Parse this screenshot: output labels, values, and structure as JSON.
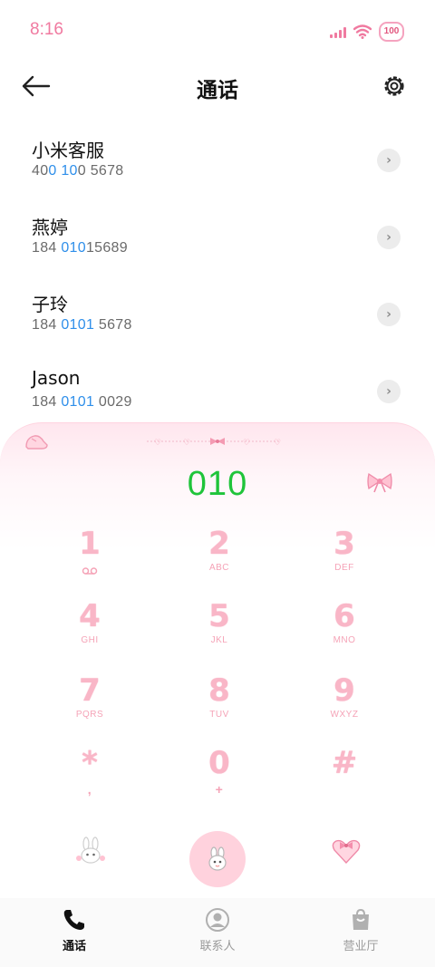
{
  "status_bar": {
    "time": "8:16",
    "battery": "100"
  },
  "header": {
    "title": "通话"
  },
  "contacts": [
    {
      "name": "小米客服",
      "number_parts": [
        "40",
        "0 10",
        "0 5678"
      ]
    },
    {
      "name": "燕婷",
      "number_parts": [
        "184 ",
        "010",
        "15689"
      ]
    },
    {
      "name": "子玲",
      "number_parts": [
        "184 ",
        "0101",
        " 5678"
      ]
    },
    {
      "name": "Jason",
      "number_parts": [
        "184 ",
        "0101",
        " 0029"
      ]
    }
  ],
  "dialer": {
    "input_value": "010",
    "keys": [
      {
        "digit": "1",
        "letters": ""
      },
      {
        "digit": "2",
        "letters": "ABC"
      },
      {
        "digit": "3",
        "letters": "DEF"
      },
      {
        "digit": "4",
        "letters": "GHI"
      },
      {
        "digit": "5",
        "letters": "JKL"
      },
      {
        "digit": "6",
        "letters": "MNO"
      },
      {
        "digit": "7",
        "letters": "PQRS"
      },
      {
        "digit": "8",
        "letters": "TUV"
      },
      {
        "digit": "9",
        "letters": "WXYZ"
      },
      {
        "digit": "*",
        "letters": ","
      },
      {
        "digit": "0",
        "letters": "+"
      },
      {
        "digit": "#",
        "letters": ""
      }
    ],
    "icons": {
      "key1_extra": "voicemail-icon",
      "left_action": "bunny-icon",
      "call": "call-icon",
      "right_action": "heart-bow-icon"
    }
  },
  "bottom_nav": [
    {
      "label": "通话",
      "active": true,
      "icon": "phone-icon"
    },
    {
      "label": "联系人",
      "active": false,
      "icon": "contact-icon"
    },
    {
      "label": "营业厅",
      "active": false,
      "icon": "shop-bag-icon"
    }
  ],
  "colors": {
    "accent_pink": "#f9b6c7",
    "dial_green": "#1fc43a",
    "highlight_blue": "#2f8fea"
  }
}
